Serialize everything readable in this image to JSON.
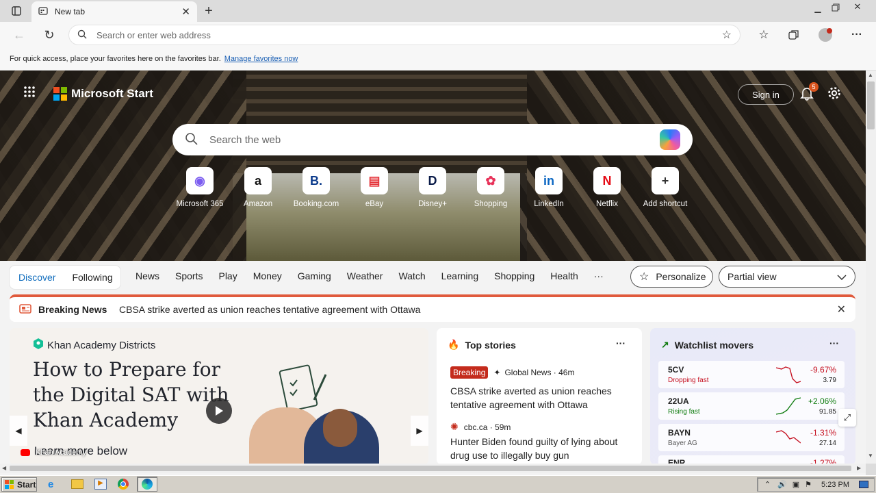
{
  "browser": {
    "tab_title": "New tab",
    "address_placeholder": "Search or enter web address",
    "favorites_hint": "For quick access, place your favorites here on the favorites bar.",
    "favorites_link": "Manage favorites now"
  },
  "hero": {
    "brand": "Microsoft Start",
    "sign_in": "Sign in",
    "notification_count": "5",
    "search_placeholder": "Search the web",
    "shortcuts": [
      {
        "label": "Microsoft 365",
        "icon": "microsoft-365-icon",
        "glyph": "◉",
        "color": "#7b5cf0"
      },
      {
        "label": "Amazon",
        "icon": "amazon-icon",
        "glyph": "a",
        "color": "#111111"
      },
      {
        "label": "Booking.com",
        "icon": "booking-icon",
        "glyph": "B.",
        "color": "#0b3b8c"
      },
      {
        "label": "eBay",
        "icon": "ebay-icon",
        "glyph": "▤",
        "color": "#e53238"
      },
      {
        "label": "Disney+",
        "icon": "disney-icon",
        "glyph": "D",
        "color": "#0b1c4a"
      },
      {
        "label": "Shopping",
        "icon": "shopping-icon",
        "glyph": "✿",
        "color": "#e8335a"
      },
      {
        "label": "LinkedIn",
        "icon": "linkedin-icon",
        "glyph": "in",
        "color": "#0a66c2"
      },
      {
        "label": "Netflix",
        "icon": "netflix-icon",
        "glyph": "N",
        "color": "#e50914"
      },
      {
        "label": "Add shortcut",
        "icon": "plus-icon",
        "glyph": "+",
        "color": "#333333"
      }
    ]
  },
  "feed": {
    "tabs": [
      "Discover",
      "Following"
    ],
    "nav": [
      "News",
      "Sports",
      "Play",
      "Money",
      "Gaming",
      "Weather",
      "Watch",
      "Learning",
      "Shopping",
      "Health",
      "···"
    ],
    "personalize": "Personalize",
    "view": "Partial view"
  },
  "breaking": {
    "label": "Breaking News",
    "headline": "CBSA strike averted as union reaches tentative agreement with Ottawa"
  },
  "khan": {
    "brand": "Khan Academy Districts",
    "headline": "How to Prepare for the Digital SAT with Khan Academy",
    "sub": "Learn more below",
    "channel": "Khan Academy"
  },
  "top_stories": {
    "title": "Top stories",
    "stories": [
      {
        "badge": "Breaking",
        "source": "Global News · 46m",
        "headline": "CBSA strike averted as union reaches tentative agreement with Ottawa"
      },
      {
        "badge": "",
        "source": "cbc.ca · 59m",
        "headline": "Hunter Biden found guilty of lying about drug use to illegally buy gun"
      }
    ]
  },
  "watchlist": {
    "title": "Watchlist movers",
    "stocks": [
      {
        "symbol": "5CV",
        "sub": "Dropping fast",
        "change": "-9.67%",
        "price": "3.79"
      },
      {
        "symbol": "22UA",
        "sub": "Rising fast",
        "change": "+2.06%",
        "price": "91.85"
      },
      {
        "symbol": "BAYN",
        "sub": "Bayer AG",
        "change": "-1.31%",
        "price": "27.14"
      },
      {
        "symbol": "ENR",
        "sub": "",
        "change": "-1.27%",
        "price": ""
      }
    ]
  },
  "taskbar": {
    "start": "Start",
    "clock": "5:23 PM"
  },
  "colors": {
    "accent": "#0f6cbd",
    "breaking": "#e05a3c",
    "up": "#107c10",
    "down": "#c50f1f"
  }
}
